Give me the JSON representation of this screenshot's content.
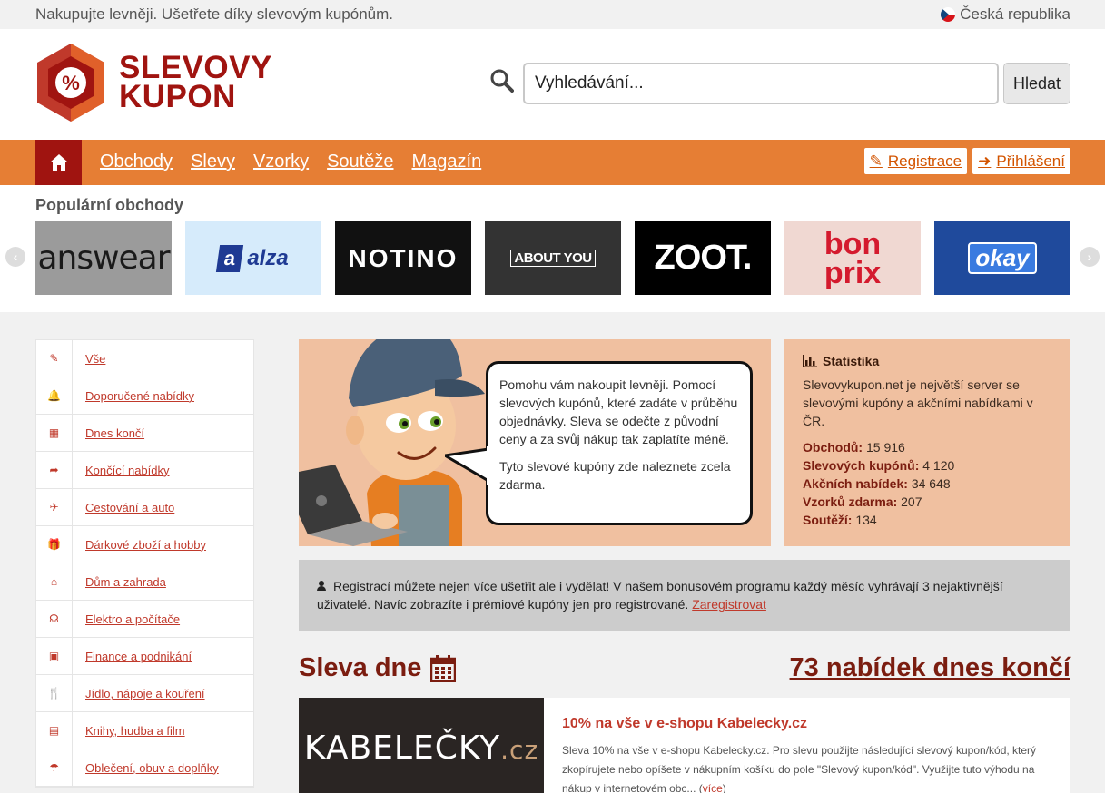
{
  "topbar": {
    "tagline": "Nakupujte levněji. Ušetřete díky slevovým kupónům.",
    "country": "Česká republika"
  },
  "header": {
    "logo_line1": "SLEVOVY",
    "logo_line2": "KUPON",
    "search_placeholder": "Vyhledávání...",
    "search_button": "Hledat"
  },
  "nav": {
    "links": [
      "Obchody",
      "Slevy",
      "Vzorky",
      "Soutěže",
      "Magazín"
    ],
    "register": "Registrace",
    "login": "Přihlášení"
  },
  "popular": {
    "heading": "Populární obchody",
    "stores": [
      {
        "name": "answear",
        "bg": "#9b9b9b",
        "color": "#1a1a1a"
      },
      {
        "name": "alza",
        "bg": "#d6ebfb",
        "color": "#1f3a93"
      },
      {
        "name": "NOTINO",
        "bg": "#111111",
        "color": "#ffffff"
      },
      {
        "name": "ABOUT YOU",
        "bg": "#333333",
        "color": "#ffffff"
      },
      {
        "name": "ZOOT.",
        "bg": "#000000",
        "color": "#ffffff"
      },
      {
        "name": "bon prix",
        "bg": "#f0d8d2",
        "color": "#d41a2e"
      },
      {
        "name": "okay",
        "bg": "#1f4a9c",
        "color": "#ffffff"
      }
    ]
  },
  "sidebar": {
    "categories": [
      {
        "label": "Vše",
        "icon": "✎"
      },
      {
        "label": "Doporučené nabídky",
        "icon": "🔔"
      },
      {
        "label": "Dnes končí",
        "icon": "▦"
      },
      {
        "label": "Končící nabídky",
        "icon": "➦"
      },
      {
        "label": "Cestování a auto",
        "icon": "✈"
      },
      {
        "label": "Dárkové zboží a hobby",
        "icon": "🎁"
      },
      {
        "label": "Dům a zahrada",
        "icon": "⌂"
      },
      {
        "label": "Elektro a počítače",
        "icon": "☊"
      },
      {
        "label": "Finance a podnikání",
        "icon": "▣"
      },
      {
        "label": "Jídlo, nápoje a kouření",
        "icon": "🍴"
      },
      {
        "label": "Knihy, hudba a film",
        "icon": "▤"
      },
      {
        "label": "Oblečení, obuv a doplňky",
        "icon": "☂"
      }
    ]
  },
  "intro": {
    "p1": "Pomohu vám nakoupit levněji. Pomocí slevových kupónů, které zadáte v průběhu objednávky. Sleva se odečte z původní ceny a za svůj nákup tak zaplatíte méně.",
    "p2": "Tyto slevové kupóny zde naleznete zcela zdarma."
  },
  "stats": {
    "title": "Statistika",
    "desc": "Slevovykupon.net je největší server se slevovými kupóny a akčními nabídkami v ČR.",
    "rows": [
      {
        "label": "Obchodů:",
        "value": "15 916"
      },
      {
        "label": "Slevových kupónů:",
        "value": "4 120"
      },
      {
        "label": "Akčních nabídek:",
        "value": "34 648"
      },
      {
        "label": "Vzorků zdarma:",
        "value": "207"
      },
      {
        "label": "Soutěží:",
        "value": "134"
      }
    ]
  },
  "notice": {
    "text": "Registrací můžete nejen více ušetřit ale i vydělat! V našem bonusovém programu každý měsíc vyhrávají 3 nejaktivnější uživatelé. Navíc zobrazíte i prémiové kupóny jen pro registrované.",
    "link": "Zaregistrovat"
  },
  "deals": {
    "title": "Sleva dne",
    "ending": "73 nabídek dnes končí",
    "item": {
      "logo": "KABELEČKY",
      "logo_suffix": ".cz",
      "title": "10% na vše v e-shopu Kabelecky.cz",
      "text": "Sleva 10% na vše v e-shopu Kabelecky.cz. Pro slevu použijte následující slevový kupon/kód, který zkopírujete nebo opíšete v nákupním košíku do pole \"Slevový kupon/kód\". Využijte tuto výhodu na nákup v internetovém obc...",
      "more": "více"
    }
  }
}
